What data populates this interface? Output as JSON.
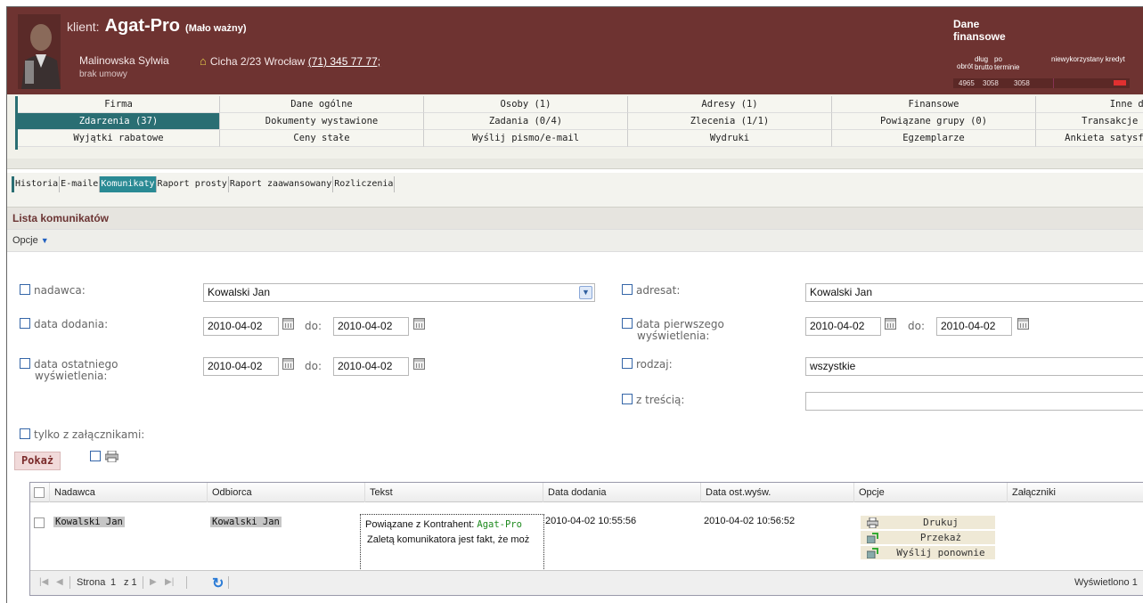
{
  "header": {
    "klient_label": "klient:",
    "client_name": "Agat-Pro",
    "importance": "(Mało ważny)",
    "person": "Malinowska Sylwia",
    "address": "Cicha 2/23 Wrocław",
    "phone": "(71) 345 77 77;",
    "contract": "brak umowy",
    "finance": {
      "title": "Dane finansowe",
      "obrot_label": "obrót",
      "dlug_label": "dług brutto",
      "po_terminie_label": "po terminie",
      "kredyt_label": "niewykorzystany kredyt",
      "obrot": "4965",
      "dlug": "3058",
      "po_terminie": "3058"
    }
  },
  "nav": {
    "rows": [
      [
        "Firma",
        "Dane ogólne",
        "Osoby (1)",
        "Adresy (1)",
        "Finansowe",
        "Inne da"
      ],
      [
        "Zdarzenia (37)",
        "Dokumenty wystawione",
        "Zadania (0/4)",
        "Zlecenia (1/1)",
        "Powiązane grupy (0)",
        "Transakcje ("
      ],
      [
        "Wyjątki rabatowe",
        "Ceny stałe",
        "Wyślij pismo/e-mail",
        "Wydruki",
        "Egzemplarze",
        "Ankieta satysfa"
      ]
    ]
  },
  "subtabs": [
    "Historia",
    "E-maile",
    "Komunikaty",
    "Raport prosty",
    "Raport zaawansowany",
    "Rozliczenia"
  ],
  "section_title": "Lista komunikatów",
  "options_label": "Opcje",
  "filters": {
    "nadawca_label": "nadawca:",
    "nadawca_value": "Kowalski Jan",
    "adresat_label": "adresat:",
    "adresat_value": "Kowalski Jan",
    "data_dodania_label": "data dodania:",
    "data_dodania_from": "2010-04-02",
    "data_dodania_to": "2010-04-02",
    "do_label": "do:",
    "data_pierwszego_label_1": "data pierwszego",
    "data_pierwszego_label_2": "wyświetlenia:",
    "data_pierwszego_from": "2010-04-02",
    "data_pierwszego_to": "2010-04-02",
    "data_ostatniego_label_1": "data ostatniego",
    "data_ostatniego_label_2": "wyświetlenia:",
    "data_ostatniego_from": "2010-04-02",
    "data_ostatniego_to": "2010-04-02",
    "rodzaj_label": "rodzaj:",
    "rodzaj_value": "wszystkie",
    "z_trescia_label": "z treścią:",
    "z_trescia_value": "",
    "zalaczniki_label": "tylko z załącznikami:",
    "show_button": "Pokaż"
  },
  "grid": {
    "columns": [
      "Nadawca",
      "Odbiorca",
      "Tekst",
      "Data dodania",
      "Data ost.wyśw.",
      "Opcje",
      "Załączniki"
    ],
    "rows": [
      {
        "nadawca": "Kowalski Jan",
        "odbiorca": "Kowalski Jan",
        "tekst_prefix": "Powiązane z Kontrahent:",
        "tekst_link": "Agat-Pro",
        "tekst_body": "Zaletą komunikatora jest fakt, że moż",
        "data_dodania": "2010-04-02 10:55:56",
        "data_ost": "2010-04-02 10:56:52",
        "options": [
          "Drukuj",
          "Przekaż",
          "Wyślij ponownie"
        ]
      }
    ],
    "pager": {
      "page_label": "Strona",
      "page": "1",
      "of_label": "z 1",
      "displayed": "Wyświetlono 1"
    }
  },
  "colors": {
    "header_bg": "#6e3331",
    "accent_teal": "#2a6e73",
    "link_green": "#1e8a1e"
  }
}
